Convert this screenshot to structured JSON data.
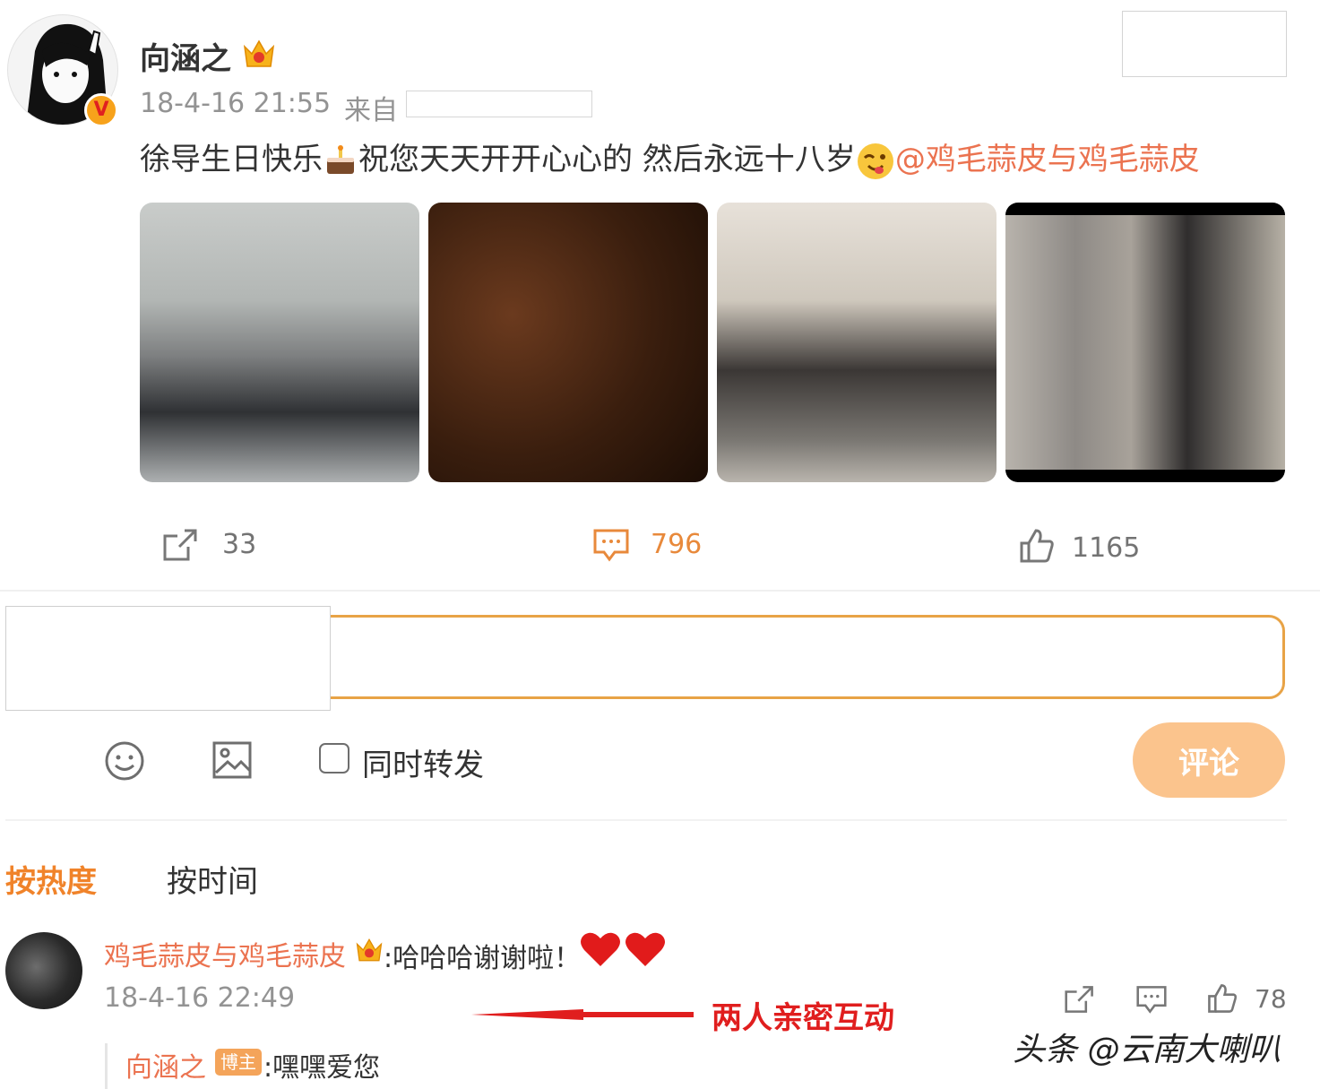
{
  "post": {
    "author": "向涵之",
    "time": "18-4-16 21:55",
    "source_label": "来自",
    "text_main": "徐导生日快乐",
    "text_mid": "祝您天天开开心心的 然后永远十八岁",
    "mention": "@鸡毛蒜皮与鸡毛蒜皮"
  },
  "actions": {
    "repost_count": "33",
    "comment_count": "796",
    "like_count": "1165"
  },
  "composer": {
    "repost_label": "同时转发",
    "submit_label": "评论"
  },
  "sort_tabs": {
    "hot": "按热度",
    "time": "按时间"
  },
  "comment": {
    "user": "鸡毛蒜皮与鸡毛蒜皮",
    "text": ":哈哈哈谢谢啦！",
    "time": "18-4-16 22:49",
    "like_count": "78",
    "reply": {
      "user": "向涵之",
      "badge": "博主",
      "text": ":嘿嘿爱您"
    }
  },
  "annotation": "两人亲密互动",
  "watermark": "头条 @云南大喇叭",
  "colors": {
    "accent_orange": "#f0832a",
    "link": "#eb7350",
    "button": "#fbc48d",
    "annotation_red": "#e01e1e"
  }
}
